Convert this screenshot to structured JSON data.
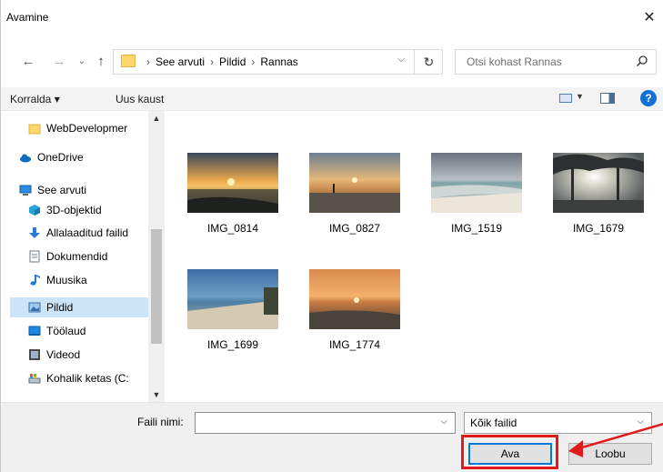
{
  "window": {
    "title": "Avamine",
    "close_glyph": "✕"
  },
  "nav": {
    "back_icon": "arrow-left-icon",
    "forward_icon": "arrow-right-icon",
    "history_icon": "chevron-down-icon",
    "up_icon": "arrow-up-icon"
  },
  "address": {
    "crumbs": [
      "See arvuti",
      "Pildid",
      "Rannas"
    ]
  },
  "search": {
    "placeholder": "Otsi kohast Rannas"
  },
  "toolbar": {
    "organize_label": "Korralda ▾",
    "new_folder_label": "Uus kaust"
  },
  "sidebar": {
    "items": [
      {
        "label": "WebDevelopmer",
        "icon": "folder-icon"
      },
      {
        "label": "OneDrive",
        "icon": "cloud-icon"
      },
      {
        "label": "See arvuti",
        "icon": "computer-icon"
      },
      {
        "label": "3D-objektid",
        "icon": "cube-icon"
      },
      {
        "label": "Allalaaditud failid",
        "icon": "download-icon"
      },
      {
        "label": "Dokumendid",
        "icon": "document-icon"
      },
      {
        "label": "Muusika",
        "icon": "music-icon"
      },
      {
        "label": "Pildid",
        "icon": "pictures-icon",
        "selected": true
      },
      {
        "label": "Töölaud",
        "icon": "desktop-icon"
      },
      {
        "label": "Videod",
        "icon": "video-icon"
      },
      {
        "label": "Kohalik ketas (C:",
        "icon": "drive-icon"
      }
    ]
  },
  "files": [
    {
      "name": "IMG_0814"
    },
    {
      "name": "IMG_0827"
    },
    {
      "name": "IMG_1519"
    },
    {
      "name": "IMG_1679"
    },
    {
      "name": "IMG_1699"
    },
    {
      "name": "IMG_1774"
    }
  ],
  "bottom": {
    "filename_label": "Faili nimi:",
    "filename_value": "",
    "filetype_value": "Kõik failid",
    "open_label": "Ava",
    "cancel_label": "Loobu"
  },
  "colors": {
    "accent": "#0078d7",
    "selection": "#cce4f7",
    "annotation": "#e11b1b"
  }
}
